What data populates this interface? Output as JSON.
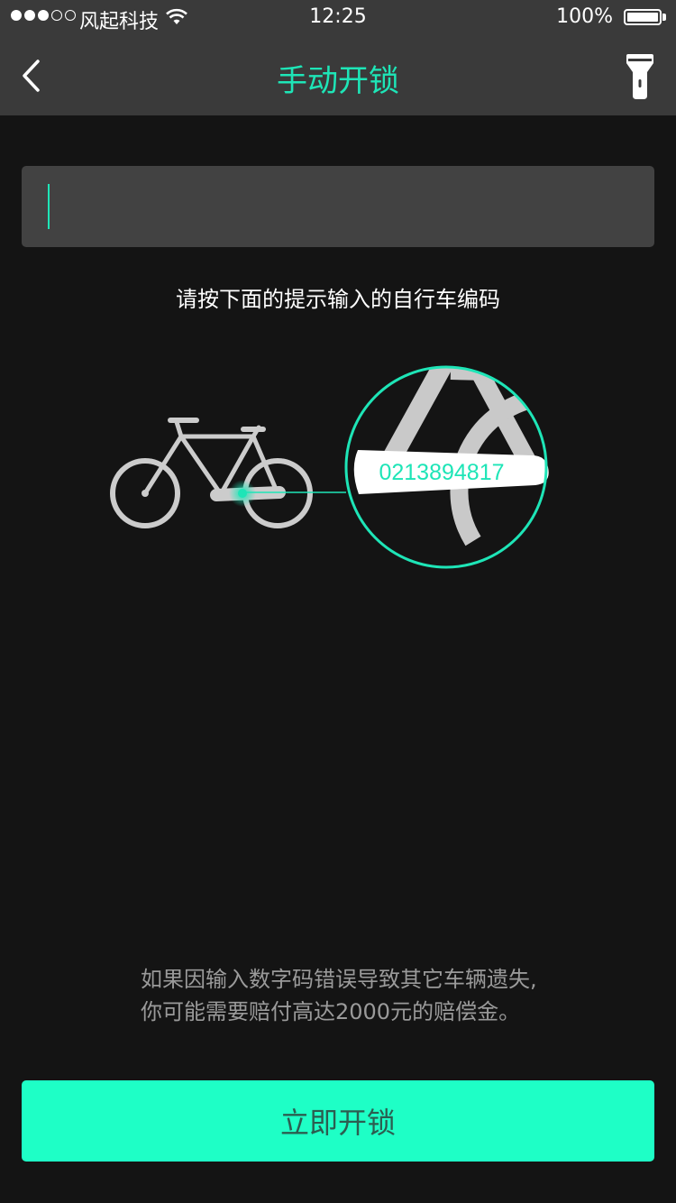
{
  "status_bar": {
    "carrier": "风起科技",
    "time": "12:25",
    "battery": "100%"
  },
  "nav": {
    "title": "手动开锁",
    "back_icon": "chevron-left-icon",
    "flashlight_icon": "flashlight-icon"
  },
  "input": {
    "value": ""
  },
  "hint": "请按下面的提示输入的自行车编码",
  "illustration": {
    "bike_code": "0213894817"
  },
  "warning": {
    "line1": "如果因输入数字码错误导致其它车辆遗失,",
    "line2": "你可能需要赔付高达2000元的赔偿金。"
  },
  "unlock_button": "立即开锁",
  "colors": {
    "accent": "#1ee5b7",
    "button_bg": "#1effc6",
    "background": "#141414",
    "bar": "#3a3a3a"
  }
}
